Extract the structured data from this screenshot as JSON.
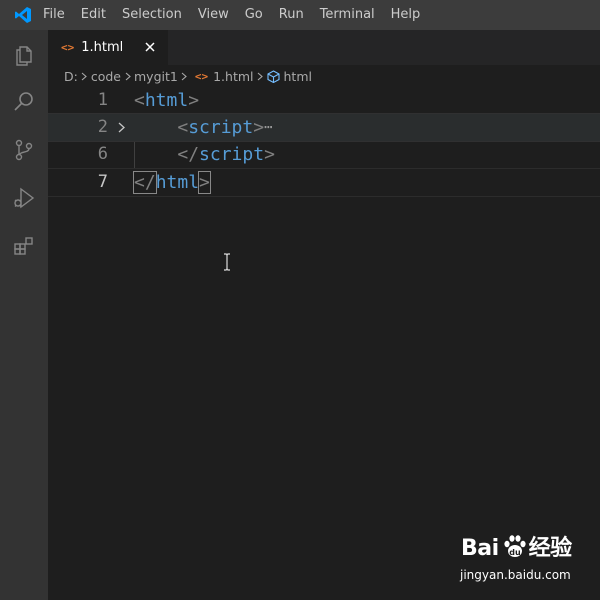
{
  "app": {
    "logo_icon": "vscode-logo-icon",
    "accent_color": "#0098ff"
  },
  "menu": [
    "File",
    "Edit",
    "Selection",
    "View",
    "Go",
    "Run",
    "Terminal",
    "Help"
  ],
  "activity_bar": {
    "icons": [
      "explorer-icon",
      "search-icon",
      "source-control-icon",
      "run-debug-icon",
      "extensions-icon"
    ]
  },
  "tabs": [
    {
      "label": "1.html",
      "icon": "html-file-icon",
      "active": true
    }
  ],
  "breadcrumb": {
    "parts": [
      "D:",
      "code",
      "mygit1",
      "1.html",
      "html"
    ]
  },
  "editor": {
    "lines": [
      {
        "number": "1",
        "open": "<",
        "tag": "html",
        "close": ">"
      },
      {
        "number": "2",
        "open": "<",
        "tag": "script",
        "close": ">",
        "folded": "⋯"
      },
      {
        "number": "6",
        "open": "</",
        "tag": "script",
        "close": ">"
      },
      {
        "number": "7",
        "open": "</",
        "tag": "html",
        "close": ">"
      }
    ]
  },
  "watermark": {
    "brand_left": "Bai",
    "brand_right": "经验",
    "url": "jingyan.baidu.com"
  }
}
